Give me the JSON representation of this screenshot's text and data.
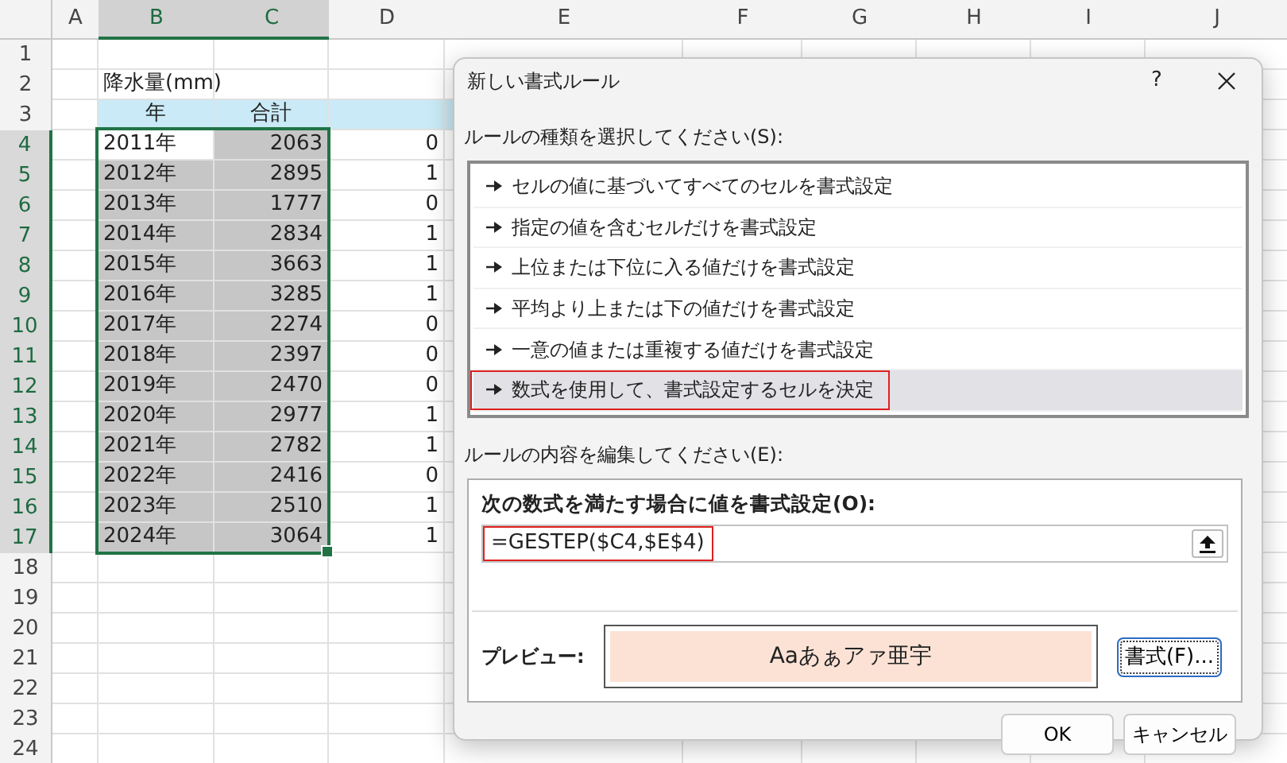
{
  "sheet": {
    "columns": [
      {
        "label": "A",
        "selected": false
      },
      {
        "label": "B",
        "selected": true
      },
      {
        "label": "C",
        "selected": true
      },
      {
        "label": "D",
        "selected": false
      },
      {
        "label": "E",
        "selected": false
      },
      {
        "label": "F",
        "selected": false
      },
      {
        "label": "G",
        "selected": false
      },
      {
        "label": "H",
        "selected": false
      },
      {
        "label": "I",
        "selected": false
      },
      {
        "label": "J",
        "selected": false
      }
    ],
    "rows": [
      {
        "number": "1",
        "selected": false
      },
      {
        "number": "2",
        "selected": false,
        "cells": [
          {
            "kind": "text",
            "text": "降水量(mm)"
          }
        ]
      },
      {
        "number": "3",
        "selected": false,
        "cells": [
          {
            "kind": "header",
            "text": "年"
          },
          {
            "kind": "header",
            "text": "合計"
          },
          {
            "kind": "header"
          },
          {
            "kind": "header"
          }
        ]
      },
      {
        "number": "4",
        "selected": true,
        "cells": [
          {
            "kind": "text",
            "text": "2011年",
            "selected": true,
            "active": true
          },
          {
            "kind": "number",
            "text": "2063",
            "selected": true,
            "active": false
          },
          {
            "kind": "number",
            "text": "0"
          }
        ]
      },
      {
        "number": "5",
        "selected": true,
        "cells": [
          {
            "kind": "text",
            "text": "2012年",
            "selected": true,
            "active": false
          },
          {
            "kind": "number",
            "text": "2895",
            "selected": true,
            "active": false
          },
          {
            "kind": "number",
            "text": "1"
          }
        ]
      },
      {
        "number": "6",
        "selected": true,
        "cells": [
          {
            "kind": "text",
            "text": "2013年",
            "selected": true,
            "active": false
          },
          {
            "kind": "number",
            "text": "1777",
            "selected": true,
            "active": false
          },
          {
            "kind": "number",
            "text": "0"
          }
        ]
      },
      {
        "number": "7",
        "selected": true,
        "cells": [
          {
            "kind": "text",
            "text": "2014年",
            "selected": true,
            "active": false
          },
          {
            "kind": "number",
            "text": "2834",
            "selected": true,
            "active": false
          },
          {
            "kind": "number",
            "text": "1"
          }
        ]
      },
      {
        "number": "8",
        "selected": true,
        "cells": [
          {
            "kind": "text",
            "text": "2015年",
            "selected": true,
            "active": false
          },
          {
            "kind": "number",
            "text": "3663",
            "selected": true,
            "active": false
          },
          {
            "kind": "number",
            "text": "1"
          }
        ]
      },
      {
        "number": "9",
        "selected": true,
        "cells": [
          {
            "kind": "text",
            "text": "2016年",
            "selected": true,
            "active": false
          },
          {
            "kind": "number",
            "text": "3285",
            "selected": true,
            "active": false
          },
          {
            "kind": "number",
            "text": "1"
          }
        ]
      },
      {
        "number": "10",
        "selected": true,
        "cells": [
          {
            "kind": "text",
            "text": "2017年",
            "selected": true,
            "active": false
          },
          {
            "kind": "number",
            "text": "2274",
            "selected": true,
            "active": false
          },
          {
            "kind": "number",
            "text": "0"
          }
        ]
      },
      {
        "number": "11",
        "selected": true,
        "cells": [
          {
            "kind": "text",
            "text": "2018年",
            "selected": true,
            "active": false
          },
          {
            "kind": "number",
            "text": "2397",
            "selected": true,
            "active": false
          },
          {
            "kind": "number",
            "text": "0"
          }
        ]
      },
      {
        "number": "12",
        "selected": true,
        "cells": [
          {
            "kind": "text",
            "text": "2019年",
            "selected": true,
            "active": false
          },
          {
            "kind": "number",
            "text": "2470",
            "selected": true,
            "active": false
          },
          {
            "kind": "number",
            "text": "0"
          }
        ]
      },
      {
        "number": "13",
        "selected": true,
        "cells": [
          {
            "kind": "text",
            "text": "2020年",
            "selected": true,
            "active": false
          },
          {
            "kind": "number",
            "text": "2977",
            "selected": true,
            "active": false
          },
          {
            "kind": "number",
            "text": "1"
          }
        ]
      },
      {
        "number": "14",
        "selected": true,
        "cells": [
          {
            "kind": "text",
            "text": "2021年",
            "selected": true,
            "active": false
          },
          {
            "kind": "number",
            "text": "2782",
            "selected": true,
            "active": false
          },
          {
            "kind": "number",
            "text": "1"
          }
        ]
      },
      {
        "number": "15",
        "selected": true,
        "cells": [
          {
            "kind": "text",
            "text": "2022年",
            "selected": true,
            "active": false
          },
          {
            "kind": "number",
            "text": "2416",
            "selected": true,
            "active": false
          },
          {
            "kind": "number",
            "text": "0"
          }
        ]
      },
      {
        "number": "16",
        "selected": true,
        "cells": [
          {
            "kind": "text",
            "text": "2023年",
            "selected": true,
            "active": false
          },
          {
            "kind": "number",
            "text": "2510",
            "selected": true,
            "active": false
          },
          {
            "kind": "number",
            "text": "1"
          }
        ]
      },
      {
        "number": "17",
        "selected": true,
        "cells": [
          {
            "kind": "text",
            "text": "2024年",
            "selected": true,
            "active": false
          },
          {
            "kind": "number",
            "text": "3064",
            "selected": true,
            "active": false
          },
          {
            "kind": "number",
            "text": "1"
          }
        ]
      },
      {
        "number": "18",
        "selected": false
      },
      {
        "number": "19",
        "selected": false
      },
      {
        "number": "20",
        "selected": false
      },
      {
        "number": "21",
        "selected": false
      },
      {
        "number": "22",
        "selected": false
      },
      {
        "number": "23",
        "selected": false
      },
      {
        "number": "24",
        "selected": false
      }
    ]
  },
  "dialog": {
    "title": "新しい書式ルール",
    "help_button": "?",
    "rule_type_label": "ルールの種類を選択してください(S):",
    "rule_types": [
      {
        "label": "セルの値に基づいてすべてのセルを書式設定",
        "selected": false,
        "highlighted": false
      },
      {
        "label": "指定の値を含むセルだけを書式設定",
        "selected": false,
        "highlighted": false
      },
      {
        "label": "上位または下位に入る値だけを書式設定",
        "selected": false,
        "highlighted": false
      },
      {
        "label": "平均より上または下の値だけを書式設定",
        "selected": false,
        "highlighted": false
      },
      {
        "label": "一意の値または重複する値だけを書式設定",
        "selected": false,
        "highlighted": false
      },
      {
        "label": "数式を使用して、書式設定するセルを決定",
        "selected": true,
        "highlighted": true
      }
    ],
    "edit_label": "ルールの内容を編集してください(E):",
    "formula_label": "次の数式を満たす場合に値を書式設定(O):",
    "formula": {
      "value": "=GESTEP($C4,$E$4)",
      "highlighted": true
    },
    "preview_label": "プレビュー:",
    "preview_text": "Aaあぁアァ亜宇",
    "format_button": "書式(F)...",
    "buttons": [
      "OK",
      "キャンセル"
    ]
  }
}
